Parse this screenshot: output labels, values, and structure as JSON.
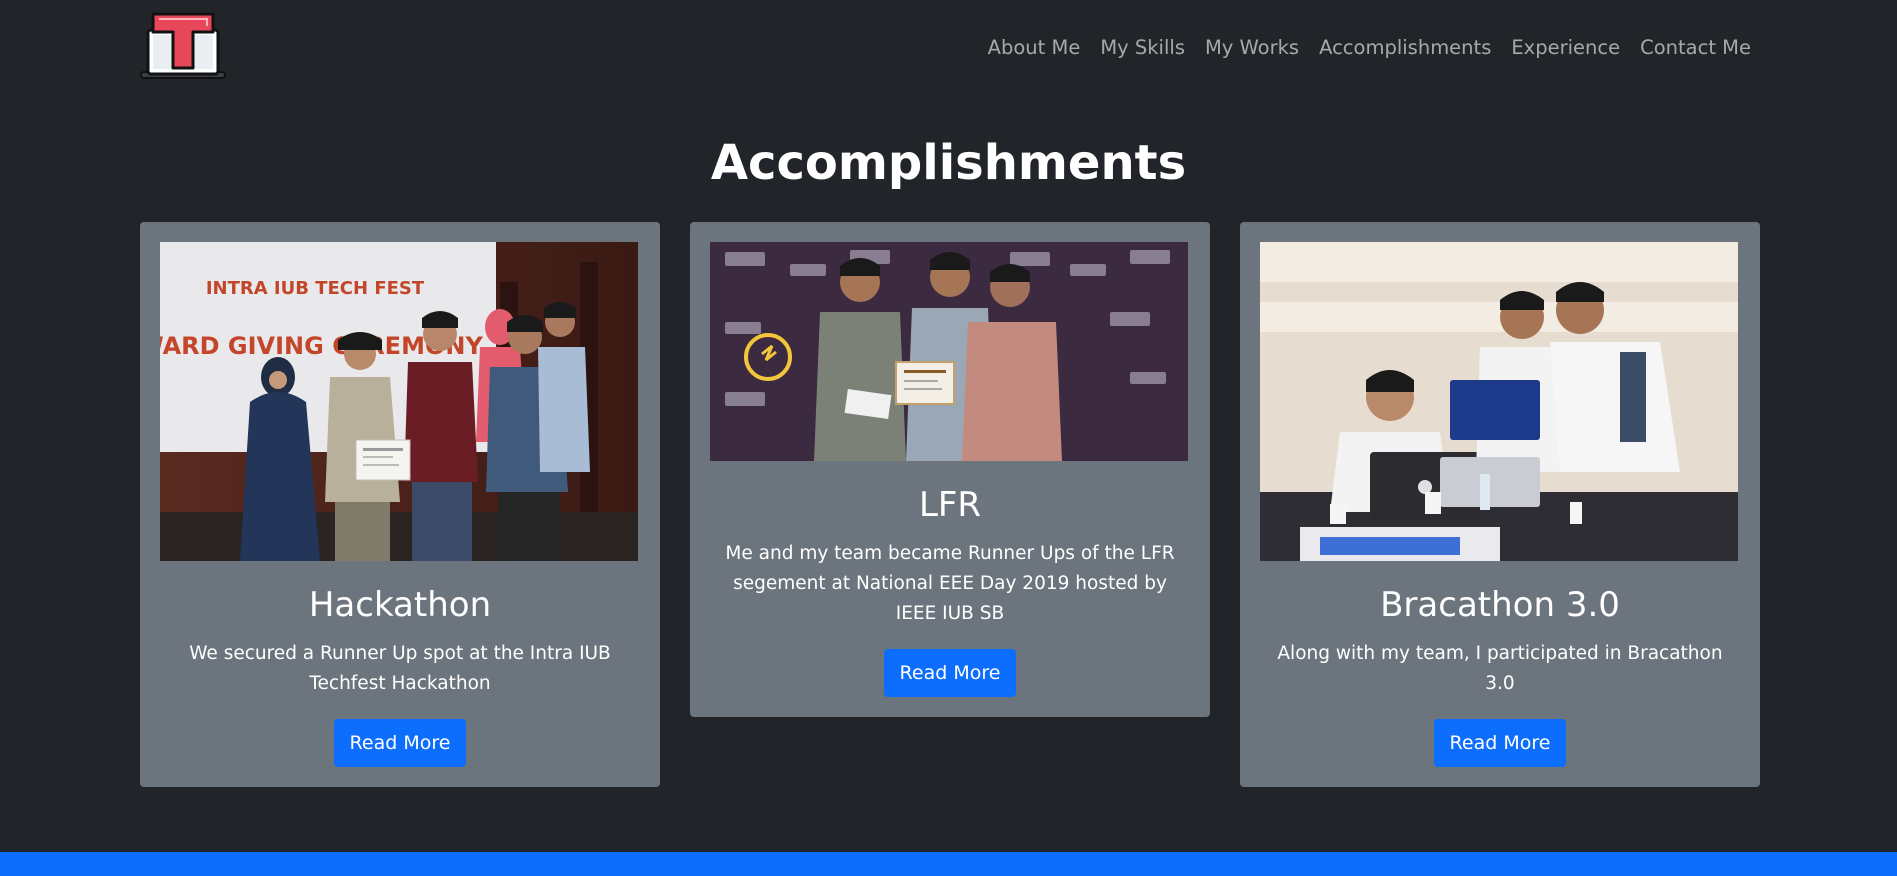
{
  "nav": {
    "items": [
      {
        "label": "About Me"
      },
      {
        "label": "My Skills"
      },
      {
        "label": "My Works"
      },
      {
        "label": "Accomplishments"
      },
      {
        "label": "Experience"
      },
      {
        "label": "Contact Me"
      }
    ]
  },
  "logo": {
    "letter": "T",
    "color": "#e8475a"
  },
  "section": {
    "title": "Accomplishments"
  },
  "cards": [
    {
      "title": "Hackathon",
      "text": "We secured a Runner Up spot at the Intra IUB Techfest Hackathon",
      "button": "Read More",
      "photo_banner": "INTRA IUB TECH FEST",
      "photo_banner_sub": "WARD GIVING CEREMONY"
    },
    {
      "title": "LFR",
      "text": "Me and my team became Runner Ups of the LFR segement at National EEE Day 2019 hosted by IEEE IUB SB",
      "button": "Read More"
    },
    {
      "title": "Bracathon 3.0",
      "text": "Along with my team, I participated in Bracathon 3.0",
      "button": "Read More"
    }
  ],
  "colors": {
    "background": "#212529",
    "card": "#6c757d",
    "primary": "#0d6efd"
  }
}
